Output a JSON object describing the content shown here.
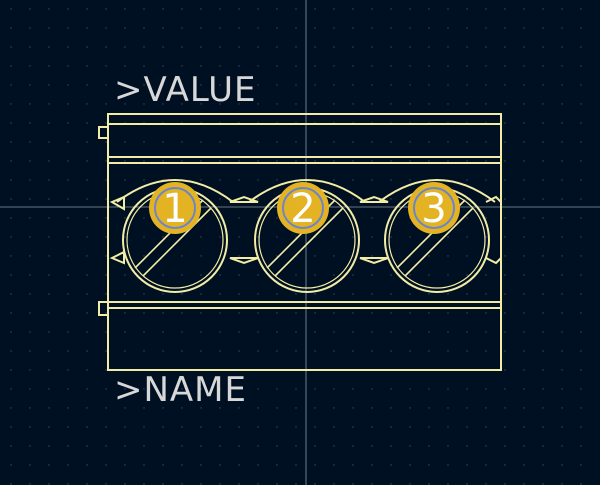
{
  "footprint": {
    "value_field": ">VALUE",
    "name_field": ">NAME",
    "pads": [
      {
        "number": "1"
      },
      {
        "number": "2"
      },
      {
        "number": "3"
      }
    ]
  },
  "colors": {
    "background": "#001023",
    "grid_dot": "#3a4a60",
    "crosshair": "#8a96a6",
    "silkscreen": "#f2eca6",
    "courtyard": "#e8e0a0",
    "pad_copper": "#e3b324",
    "pad_hole_outline": "#6a86c8",
    "pad_text": "#ffffff",
    "field_text": "#d8d8d8"
  }
}
